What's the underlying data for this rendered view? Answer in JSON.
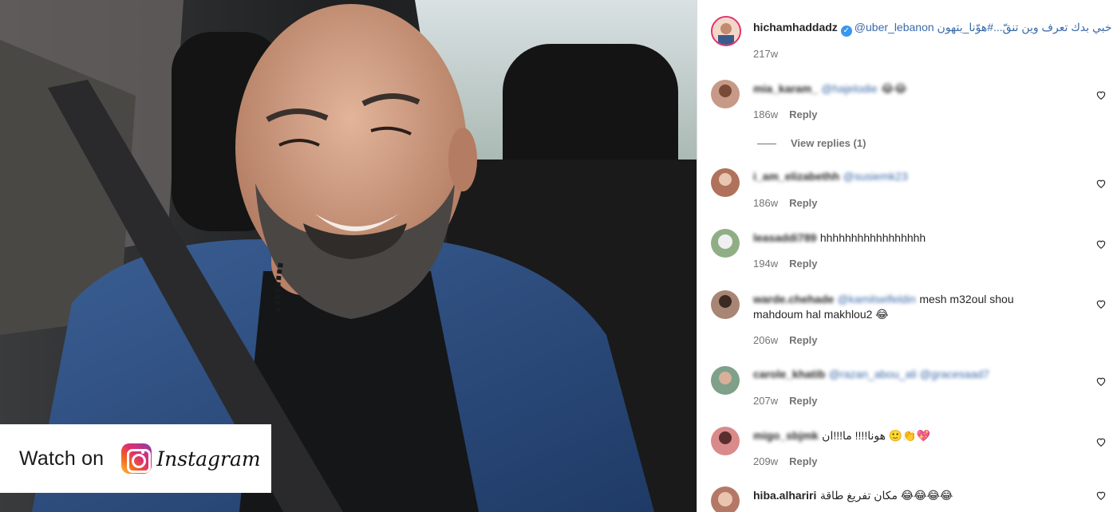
{
  "video": {
    "watch_label": "Watch on",
    "platform_word": "Instagram",
    "icons": [
      "instagram-icon"
    ]
  },
  "post": {
    "username": "hichamhaddadz",
    "caption": "@uber_lebanon خبي بدك تعرف وين تنقّ...#هوّنا_بتهون",
    "time": "217w"
  },
  "comments": [
    {
      "username": "mia_karam_",
      "mention": "@hajelodie",
      "text": "😂😂",
      "time": "186w",
      "reply": "Reply"
    },
    {
      "username": "i_am_elizabethh",
      "mention": "@susiemk23",
      "text": "",
      "time": "186w",
      "reply": "Reply"
    },
    {
      "username": "leasaddi789",
      "mention": "",
      "text": "hhhhhhhhhhhhhhhhh",
      "time": "194w",
      "reply": "Reply"
    },
    {
      "username": "warde.chehade",
      "mention": "@kamilselfeldin",
      "text": "mesh m32oul shou",
      "text2": "mahdoum hal makhlou2 😂",
      "time": "206w",
      "reply": "Reply"
    },
    {
      "username": "carole_khatib",
      "mention": "@razan_abou_ali @gracesaad7",
      "text": "",
      "time": "207w",
      "reply": "Reply"
    },
    {
      "username": "migo_sbjmk",
      "mention": "",
      "text": "هونا!!!! ما!!!ان 🙂👏💖",
      "time": "209w",
      "reply": "Reply"
    },
    {
      "username": "hiba.alhariri",
      "mention": "",
      "text": "مكان تفريغ طاقة 😂😂😂😂",
      "time": "",
      "reply": ""
    }
  ],
  "view_replies": "View replies (1)",
  "colors": {
    "verified": "#3897f0",
    "mention": "#3b6aa8",
    "meta": "#737373"
  }
}
